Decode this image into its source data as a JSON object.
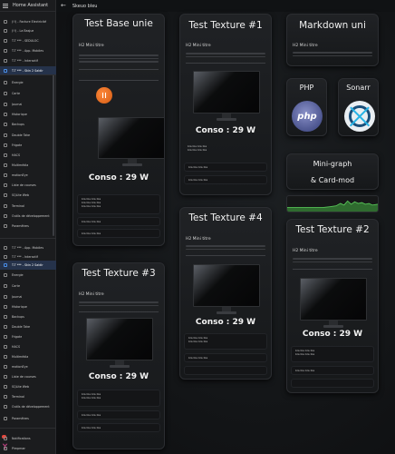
{
  "app": {
    "title": "Home Assistant"
  },
  "header": {
    "title": "Skeuo bleu"
  },
  "sidebar": {
    "items": [
      {
        "label": "(!!) - Facture Electricité"
      },
      {
        "label": "(!!) - La Basjue"
      },
      {
        "label": "T.T *** - SEDULOC"
      },
      {
        "label": "T.T *** - App. Mobiles"
      },
      {
        "label": "T.T *** - Interactif"
      },
      {
        "label": "T.T *** - Skin 2 Saldir"
      },
      {
        "label": "Énergie"
      },
      {
        "label": "Carte"
      },
      {
        "label": "Journal"
      },
      {
        "label": "Historique"
      },
      {
        "label": "Backups"
      },
      {
        "label": "Double Take"
      },
      {
        "label": "Frigate"
      },
      {
        "label": "HACS"
      },
      {
        "label": "Multimédia"
      },
      {
        "label": "motionEye"
      },
      {
        "label": "Liste de courses"
      },
      {
        "label": "SQLite Web"
      },
      {
        "label": "Terminal"
      },
      {
        "label": "Outils de développement"
      },
      {
        "label": "Paramètres"
      },
      {
        "label": "T.T *** - App. Mobiles"
      },
      {
        "label": "T.T *** - Interactif"
      },
      {
        "label": "T.T *** - Skin 2 Saldir"
      },
      {
        "label": "Énergie"
      },
      {
        "label": "Carte"
      },
      {
        "label": "Journal"
      },
      {
        "label": "Historique"
      },
      {
        "label": "Backups"
      },
      {
        "label": "Double Take"
      },
      {
        "label": "Frigate"
      },
      {
        "label": "HACS"
      },
      {
        "label": "Multimédia"
      },
      {
        "label": "motionEye"
      },
      {
        "label": "Liste de courses"
      },
      {
        "label": "SQLite Web"
      },
      {
        "label": "Terminal"
      },
      {
        "label": "Outils de développement"
      },
      {
        "label": "Paramètres"
      },
      {
        "label": "Notifications"
      },
      {
        "label": "Pimpman"
      }
    ]
  },
  "cards": {
    "base_unie": {
      "title": "Test Base unie",
      "subtitle": "H2 Mini titre",
      "conso": "Conso : 29 W",
      "rows": [
        "bla bla bla bla",
        "bla bla bla bla",
        "bla bla bla bla",
        "bla bla bla bla",
        "bla bla bla bla"
      ]
    },
    "texture1": {
      "title": "Test Texture #1",
      "subtitle": "H2 Mini titre",
      "conso": "Conso : 29 W",
      "rows": [
        "bla bla bla bla",
        "bla bla bla bla",
        "bla bla bla bla",
        "bla bla bla bla"
      ]
    },
    "markdown": {
      "title": "Markdown uni",
      "subtitle": "H2 Mini titre"
    },
    "php": {
      "title": "PHP",
      "logo": "php"
    },
    "sonarr": {
      "title": "Sonarr"
    },
    "minigraph": {
      "title_line1": "Mini-graph",
      "title_line2": "& Card-mod"
    },
    "texture3": {
      "title": "Test Texture #3",
      "subtitle": "H2 Mini titre",
      "conso": "Conso : 29 W",
      "rows": [
        "bla bla bla bla",
        "bla bla bla bla",
        "bla bla bla bla",
        "bla bla bla bla"
      ]
    },
    "texture4": {
      "title": "Test Texture #4",
      "subtitle": "H2 Mini titre",
      "conso": "Conso : 29 W",
      "rows": [
        "bla bla bla bla",
        "bla bla bla bla",
        "bla bla bla bla"
      ]
    },
    "texture2": {
      "title": "Test Texture #2",
      "subtitle": "H2 Mini titre",
      "conso": "Conso : 29 W",
      "rows": [
        "bla bla bla bla",
        "bla bla bla bla",
        "bla bla bla bla"
      ]
    }
  },
  "colors": {
    "accent": "#4a8ee8",
    "badge": "#e66a1e",
    "graph": "#3fae3f"
  }
}
